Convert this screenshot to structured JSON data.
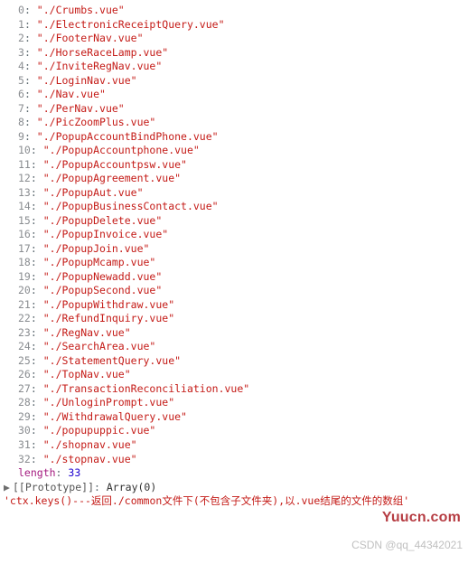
{
  "entries": [
    {
      "index": "0",
      "value": "\"./Crumbs.vue\""
    },
    {
      "index": "1",
      "value": "\"./ElectronicReceiptQuery.vue\""
    },
    {
      "index": "2",
      "value": "\"./FooterNav.vue\""
    },
    {
      "index": "3",
      "value": "\"./HorseRaceLamp.vue\""
    },
    {
      "index": "4",
      "value": "\"./InviteRegNav.vue\""
    },
    {
      "index": "5",
      "value": "\"./LoginNav.vue\""
    },
    {
      "index": "6",
      "value": "\"./Nav.vue\""
    },
    {
      "index": "7",
      "value": "\"./PerNav.vue\""
    },
    {
      "index": "8",
      "value": "\"./PicZoomPlus.vue\""
    },
    {
      "index": "9",
      "value": "\"./PopupAccountBindPhone.vue\""
    },
    {
      "index": "10",
      "value": "\"./PopupAccountphone.vue\""
    },
    {
      "index": "11",
      "value": "\"./PopupAccountpsw.vue\""
    },
    {
      "index": "12",
      "value": "\"./PopupAgreement.vue\""
    },
    {
      "index": "13",
      "value": "\"./PopupAut.vue\""
    },
    {
      "index": "14",
      "value": "\"./PopupBusinessContact.vue\""
    },
    {
      "index": "15",
      "value": "\"./PopupDelete.vue\""
    },
    {
      "index": "16",
      "value": "\"./PopupInvoice.vue\""
    },
    {
      "index": "17",
      "value": "\"./PopupJoin.vue\""
    },
    {
      "index": "18",
      "value": "\"./PopupMcamp.vue\""
    },
    {
      "index": "19",
      "value": "\"./PopupNewadd.vue\""
    },
    {
      "index": "20",
      "value": "\"./PopupSecond.vue\""
    },
    {
      "index": "21",
      "value": "\"./PopupWithdraw.vue\""
    },
    {
      "index": "22",
      "value": "\"./RefundInquiry.vue\""
    },
    {
      "index": "23",
      "value": "\"./RegNav.vue\""
    },
    {
      "index": "24",
      "value": "\"./SearchArea.vue\""
    },
    {
      "index": "25",
      "value": "\"./StatementQuery.vue\""
    },
    {
      "index": "26",
      "value": "\"./TopNav.vue\""
    },
    {
      "index": "27",
      "value": "\"./TransactionReconciliation.vue\""
    },
    {
      "index": "28",
      "value": "\"./UnloginPrompt.vue\""
    },
    {
      "index": "29",
      "value": "\"./WithdrawalQuery.vue\""
    },
    {
      "index": "30",
      "value": "\"./popupuppic.vue\""
    },
    {
      "index": "31",
      "value": "\"./shopnav.vue\""
    },
    {
      "index": "32",
      "value": "\"./stopnav.vue\""
    }
  ],
  "length_label": "length",
  "length_value": "33",
  "prototype": {
    "tri": "▶",
    "label": "[[Prototype]]",
    "value": "Array(0)"
  },
  "comment": "'ctx.keys()---返回./common文件下(不包含子文件夹),以.vue结尾的文件的数组'",
  "watermark1": "Yuucn.com",
  "watermark2": "CSDN @qq_44342021",
  "colors": {
    "index": "#8a8d91",
    "string": "#c41a16",
    "lengthKey": "#a41a7f",
    "number": "#1c00cf"
  }
}
